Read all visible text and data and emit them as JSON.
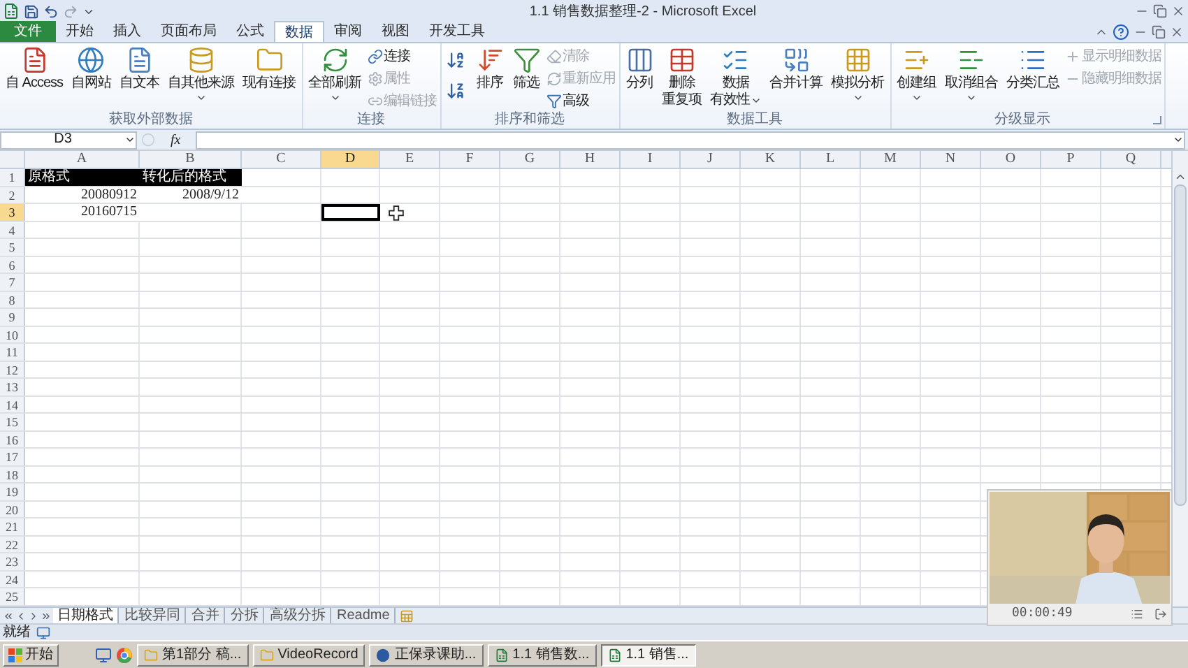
{
  "window": {
    "title": "1.1 销售数据整理-2 - Microsoft Excel"
  },
  "ribbon_tabs": [
    {
      "label": "文件",
      "kind": "file",
      "selected": false
    },
    {
      "label": "开始",
      "kind": "tab",
      "selected": false
    },
    {
      "label": "插入",
      "kind": "tab",
      "selected": false
    },
    {
      "label": "页面布局",
      "kind": "tab",
      "selected": false
    },
    {
      "label": "公式",
      "kind": "tab",
      "selected": false
    },
    {
      "label": "数据",
      "kind": "tab",
      "selected": true
    },
    {
      "label": "审阅",
      "kind": "tab",
      "selected": false
    },
    {
      "label": "视图",
      "kind": "tab",
      "selected": false
    },
    {
      "label": "开发工具",
      "kind": "tab",
      "selected": false
    }
  ],
  "ribbon_groups": [
    {
      "label": "获取外部数据",
      "launcher": false,
      "columns": [
        {
          "kind": "large",
          "lines": [
            "自 Access"
          ],
          "has_menu": false
        },
        {
          "kind": "large",
          "lines": [
            "自网站"
          ],
          "has_menu": false
        },
        {
          "kind": "large",
          "lines": [
            "自文本"
          ],
          "has_menu": false
        },
        {
          "kind": "large",
          "lines": [
            "自其他来源"
          ],
          "has_menu": true
        },
        {
          "kind": "large",
          "lines": [
            "现有连接"
          ],
          "has_menu": false
        }
      ]
    },
    {
      "label": "连接",
      "launcher": false,
      "columns": [
        {
          "kind": "large",
          "lines": [
            "全部刷新"
          ],
          "has_menu": true
        },
        {
          "kind": "stack",
          "items": [
            {
              "label": "连接",
              "disabled": false
            },
            {
              "label": "属性",
              "disabled": true
            },
            {
              "label": "编辑链接",
              "disabled": true
            }
          ]
        }
      ]
    },
    {
      "label": "排序和筛选",
      "launcher": false,
      "columns": [
        {
          "kind": "icons"
        },
        {
          "kind": "large",
          "lines": [
            "排序"
          ],
          "has_menu": false
        },
        {
          "kind": "large",
          "lines": [
            "筛选"
          ],
          "has_menu": false
        },
        {
          "kind": "stack",
          "items": [
            {
              "label": "清除",
              "disabled": true
            },
            {
              "label": "重新应用",
              "disabled": true
            },
            {
              "label": "高级",
              "disabled": false
            }
          ]
        }
      ]
    },
    {
      "label": "数据工具",
      "launcher": false,
      "columns": [
        {
          "kind": "large",
          "lines": [
            "分列"
          ],
          "has_menu": false
        },
        {
          "kind": "large",
          "lines": [
            "删除",
            "重复项"
          ],
          "has_menu": false
        },
        {
          "kind": "large",
          "lines": [
            "数据",
            "有效性"
          ],
          "has_menu": true
        },
        {
          "kind": "large",
          "lines": [
            "合并计算"
          ],
          "has_menu": false
        },
        {
          "kind": "large",
          "lines": [
            "模拟分析"
          ],
          "has_menu": true
        }
      ]
    },
    {
      "label": "分级显示",
      "launcher": true,
      "columns": [
        {
          "kind": "large",
          "lines": [
            "创建组"
          ],
          "has_menu": true
        },
        {
          "kind": "large",
          "lines": [
            "取消组合"
          ],
          "has_menu": true
        },
        {
          "kind": "large",
          "lines": [
            "分类汇总"
          ],
          "has_menu": false
        },
        {
          "kind": "stack",
          "items": [
            {
              "label": "显示明细数据",
              "disabled": true
            },
            {
              "label": "隐藏明细数据",
              "disabled": true
            }
          ]
        }
      ]
    }
  ],
  "formula_bar": {
    "name_box": "D3",
    "function_label": "fx"
  },
  "columns": [
    {
      "label": "A",
      "selected": false
    },
    {
      "label": "B",
      "selected": false
    },
    {
      "label": "C",
      "selected": false
    },
    {
      "label": "D",
      "selected": true
    },
    {
      "label": "E",
      "selected": false
    },
    {
      "label": "F",
      "selected": false
    },
    {
      "label": "G",
      "selected": false
    },
    {
      "label": "H",
      "selected": false
    },
    {
      "label": "I",
      "selected": false
    },
    {
      "label": "J",
      "selected": false
    },
    {
      "label": "K",
      "selected": false
    },
    {
      "label": "L",
      "selected": false
    },
    {
      "label": "M",
      "selected": false
    },
    {
      "label": "N",
      "selected": false
    },
    {
      "label": "O",
      "selected": false
    },
    {
      "label": "P",
      "selected": false
    },
    {
      "label": "Q",
      "selected": false
    }
  ],
  "rows": [
    {
      "header": "1",
      "selected": false,
      "cells": [
        {
          "text": "原格式",
          "kind": "heading"
        },
        {
          "text": "转化后的格式",
          "kind": "heading"
        }
      ]
    },
    {
      "header": "2",
      "selected": false,
      "cells": [
        {
          "text": "20080912",
          "kind": "number"
        },
        {
          "text": "2008/9/12",
          "kind": "number"
        }
      ]
    },
    {
      "header": "3",
      "selected": true,
      "cells": [
        {
          "text": "20160715",
          "kind": "number"
        }
      ]
    },
    {
      "header": "4",
      "selected": false
    },
    {
      "header": "5",
      "selected": false
    },
    {
      "header": "6",
      "selected": false
    },
    {
      "header": "7",
      "selected": false
    },
    {
      "header": "8",
      "selected": false
    },
    {
      "header": "9",
      "selected": false
    },
    {
      "header": "10",
      "selected": false
    },
    {
      "header": "11",
      "selected": false
    },
    {
      "header": "12",
      "selected": false
    },
    {
      "header": "13",
      "selected": false
    },
    {
      "header": "14",
      "selected": false
    },
    {
      "header": "15",
      "selected": false
    },
    {
      "header": "16",
      "selected": false
    },
    {
      "header": "17",
      "selected": false
    },
    {
      "header": "18",
      "selected": false
    },
    {
      "header": "19",
      "selected": false
    },
    {
      "header": "20",
      "selected": false
    },
    {
      "header": "21",
      "selected": false
    },
    {
      "header": "22",
      "selected": false
    },
    {
      "header": "23",
      "selected": false
    },
    {
      "header": "24",
      "selected": false
    },
    {
      "header": "25",
      "selected": false
    }
  ],
  "sheet_tabs": [
    {
      "label": "日期格式",
      "selected": true
    },
    {
      "label": "比较异同",
      "selected": false
    },
    {
      "label": "合并",
      "selected": false
    },
    {
      "label": "分拆",
      "selected": false
    },
    {
      "label": "高级分拆",
      "selected": false
    },
    {
      "label": "Readme",
      "selected": false
    }
  ],
  "status_bar": {
    "text": "就绪"
  },
  "taskbar": {
    "start": "开始",
    "items": [
      {
        "label": "第1部分 稿...",
        "kind": "folder",
        "selected": false
      },
      {
        "label": "VideoRecord",
        "kind": "folder",
        "selected": false
      },
      {
        "label": "正保录课助...",
        "kind": "recorder",
        "selected": false
      },
      {
        "label": "1.1 销售数...",
        "kind": "excel",
        "selected": false
      },
      {
        "label": "1.1 销售...",
        "kind": "excel",
        "selected": true
      }
    ]
  },
  "video_overlay": {
    "kind": "picture",
    "time": "00:00:49"
  }
}
